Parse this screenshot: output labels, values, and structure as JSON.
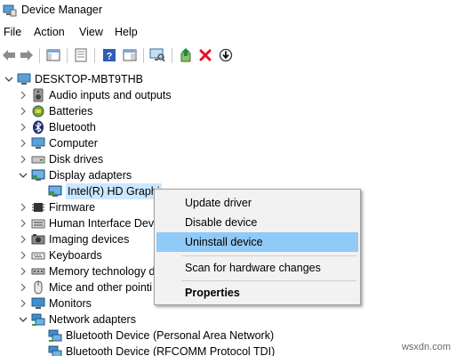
{
  "window": {
    "title": "Device Manager",
    "icon": "device-manager-icon"
  },
  "menu": [
    "File",
    "Action",
    "View",
    "Help"
  ],
  "toolbar": {
    "buttons": [
      "back-arrow-icon",
      "forward-arrow-icon",
      "show-hide-console-tree-icon",
      "properties-icon",
      "help-icon",
      "action-pane-icon",
      "scan-monitor-icon",
      "update-driver-icon",
      "uninstall-red-x-icon",
      "download-arrow-icon"
    ],
    "colors": {
      "update": "#1e8a3a",
      "uninstall": "#e81123"
    }
  },
  "tree": {
    "root": "DESKTOP-MBT9THB",
    "items": [
      {
        "label": "Audio inputs and outputs",
        "icon": "speaker-icon",
        "expanded": false
      },
      {
        "label": "Batteries",
        "icon": "battery-icon",
        "expanded": false
      },
      {
        "label": "Bluetooth",
        "icon": "bluetooth-icon",
        "expanded": false
      },
      {
        "label": "Computer",
        "icon": "computer-icon",
        "expanded": false
      },
      {
        "label": "Disk drives",
        "icon": "disk-drive-icon",
        "expanded": false
      },
      {
        "label": "Display adapters",
        "icon": "display-adapter-icon",
        "expanded": true
      },
      {
        "label": "Intel(R) HD Graphi",
        "icon": "display-adapter-icon",
        "child": true,
        "selected": true
      },
      {
        "label": "Firmware",
        "icon": "firmware-chip-icon",
        "expanded": false
      },
      {
        "label": "Human Interface Devi",
        "icon": "hid-icon",
        "expanded": false
      },
      {
        "label": "Imaging devices",
        "icon": "camera-icon",
        "expanded": false
      },
      {
        "label": "Keyboards",
        "icon": "keyboard-icon",
        "expanded": false
      },
      {
        "label": "Memory technology d",
        "icon": "memory-icon",
        "expanded": false
      },
      {
        "label": "Mice and other pointi",
        "icon": "mouse-icon",
        "expanded": false
      },
      {
        "label": "Monitors",
        "icon": "monitor-icon",
        "expanded": false
      },
      {
        "label": "Network adapters",
        "icon": "network-adapter-icon",
        "expanded": true
      },
      {
        "label": "Bluetooth Device (Personal Area Network)",
        "icon": "network-adapter-icon",
        "child": true
      },
      {
        "label": "Bluetooth Device (RFCOMM Protocol TDI)",
        "icon": "network-adapter-icon",
        "child": true
      }
    ]
  },
  "context_menu": {
    "items": [
      "Update driver",
      "Disable device",
      "Uninstall device",
      "Scan for hardware changes",
      "Properties"
    ],
    "highlighted": "Uninstall device",
    "highlight_color": "#91c9f7"
  },
  "watermark": "wsxdn.com"
}
